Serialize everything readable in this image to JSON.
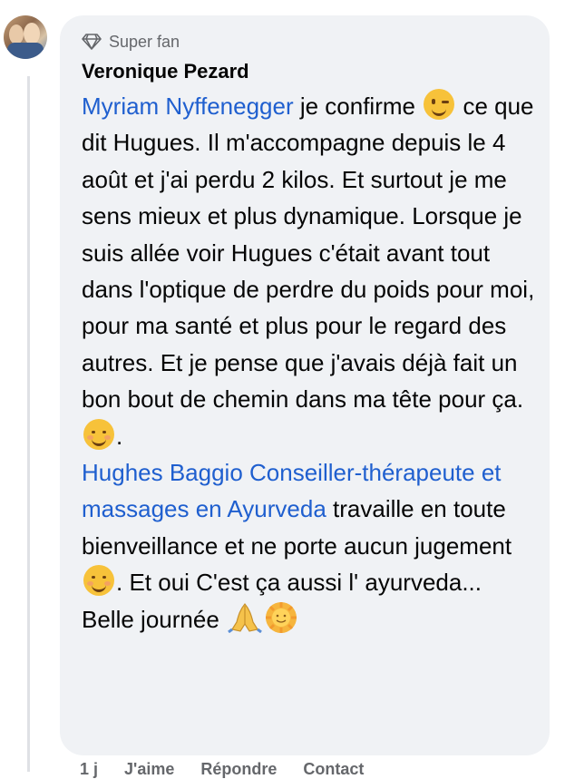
{
  "comment": {
    "badge_label": "Super fan",
    "badge_icon": "diamond-icon",
    "author": "Veronique Pezard",
    "mention1": "Myriam Nyffenegger",
    "text1": " je confirme ",
    "text2": " ce que dit Hugues. Il m'accompagne depuis le 4 août et j'ai perdu 2 kilos. Et surtout je me sens mieux et plus dynamique. Lorsque je suis allée voir Hugues c'était avant tout dans l'optique de perdre du poids pour moi, pour ma santé et plus pour le regard des autres. Et je pense que j'avais déjà fait un bon bout de chemin dans ma tête pour ça. ",
    "text3": ".",
    "mention2": "Hughes Baggio Conseiller-thérapeute et massages en Ayurveda",
    "text4": " travaille en toute bienveillance et ne porte aucun jugement ",
    "text5": ". Et oui C'est ça aussi l' ayurveda... Belle journée ",
    "emoji_wink": "winking-face-emoji",
    "emoji_relaxed": "smiling-face-emoji",
    "emoji_smile": "smiling-eyes-emoji",
    "emoji_pray": "folded-hands-emoji",
    "emoji_sun": "sun-with-face-emoji"
  },
  "actions": {
    "time": "1 j",
    "like": "J'aime",
    "reply": "Répondre",
    "contact": "Contact"
  }
}
